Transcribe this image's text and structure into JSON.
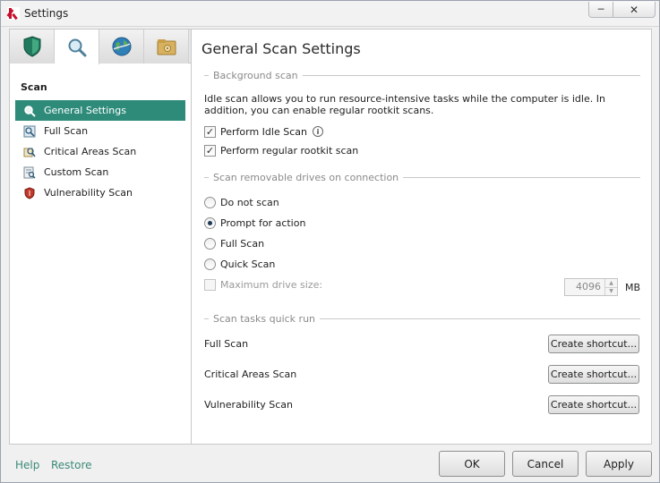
{
  "window": {
    "title": "Settings"
  },
  "caption_buttons": {
    "minimize": "─",
    "close": "✕"
  },
  "tabs": [
    {
      "name": "protection",
      "icon": "shield-icon"
    },
    {
      "name": "scan",
      "icon": "magnifier-icon"
    },
    {
      "name": "update",
      "icon": "globe-icon"
    },
    {
      "name": "advanced",
      "icon": "folder-gear-icon"
    }
  ],
  "sidebar": {
    "section_title": "Scan",
    "items": [
      {
        "label": "General Settings",
        "icon": "magnifier-icon"
      },
      {
        "label": "Full Scan",
        "icon": "full-scan-icon"
      },
      {
        "label": "Critical Areas Scan",
        "icon": "critical-areas-icon"
      },
      {
        "label": "Custom Scan",
        "icon": "custom-scan-icon"
      },
      {
        "label": "Vulnerability Scan",
        "icon": "vulnerability-shield-icon"
      }
    ]
  },
  "main": {
    "title": "General Scan Settings",
    "background_scan": {
      "header": "Background scan",
      "description": "Idle scan allows you to run resource-intensive tasks while the computer is idle. In addition, you can enable regular rootkit scans.",
      "perform_idle_scan": {
        "label": "Perform Idle Scan",
        "checked": true
      },
      "perform_rootkit_scan": {
        "label": "Perform regular rootkit scan",
        "checked": true
      }
    },
    "removable": {
      "header": "Scan removable drives on connection",
      "options": [
        {
          "label": "Do not scan",
          "selected": false
        },
        {
          "label": "Prompt for action",
          "selected": true
        },
        {
          "label": "Full Scan",
          "selected": false
        },
        {
          "label": "Quick Scan",
          "selected": false
        }
      ],
      "max_drive_size": {
        "label": "Maximum drive size:",
        "checked": false,
        "value": "4096",
        "unit": "MB"
      }
    },
    "quick_run": {
      "header": "Scan tasks quick run",
      "tasks": [
        {
          "label": "Full Scan",
          "button": "Create shortcut..."
        },
        {
          "label": "Critical Areas Scan",
          "button": "Create shortcut..."
        },
        {
          "label": "Vulnerability Scan",
          "button": "Create shortcut..."
        }
      ]
    }
  },
  "footer": {
    "help": "Help",
    "restore": "Restore",
    "ok": "OK",
    "cancel": "Cancel",
    "apply": "Apply"
  },
  "colors": {
    "accent": "#2e8b7a",
    "link": "#3a8a78",
    "kaspersky_red": "#c8102e"
  }
}
